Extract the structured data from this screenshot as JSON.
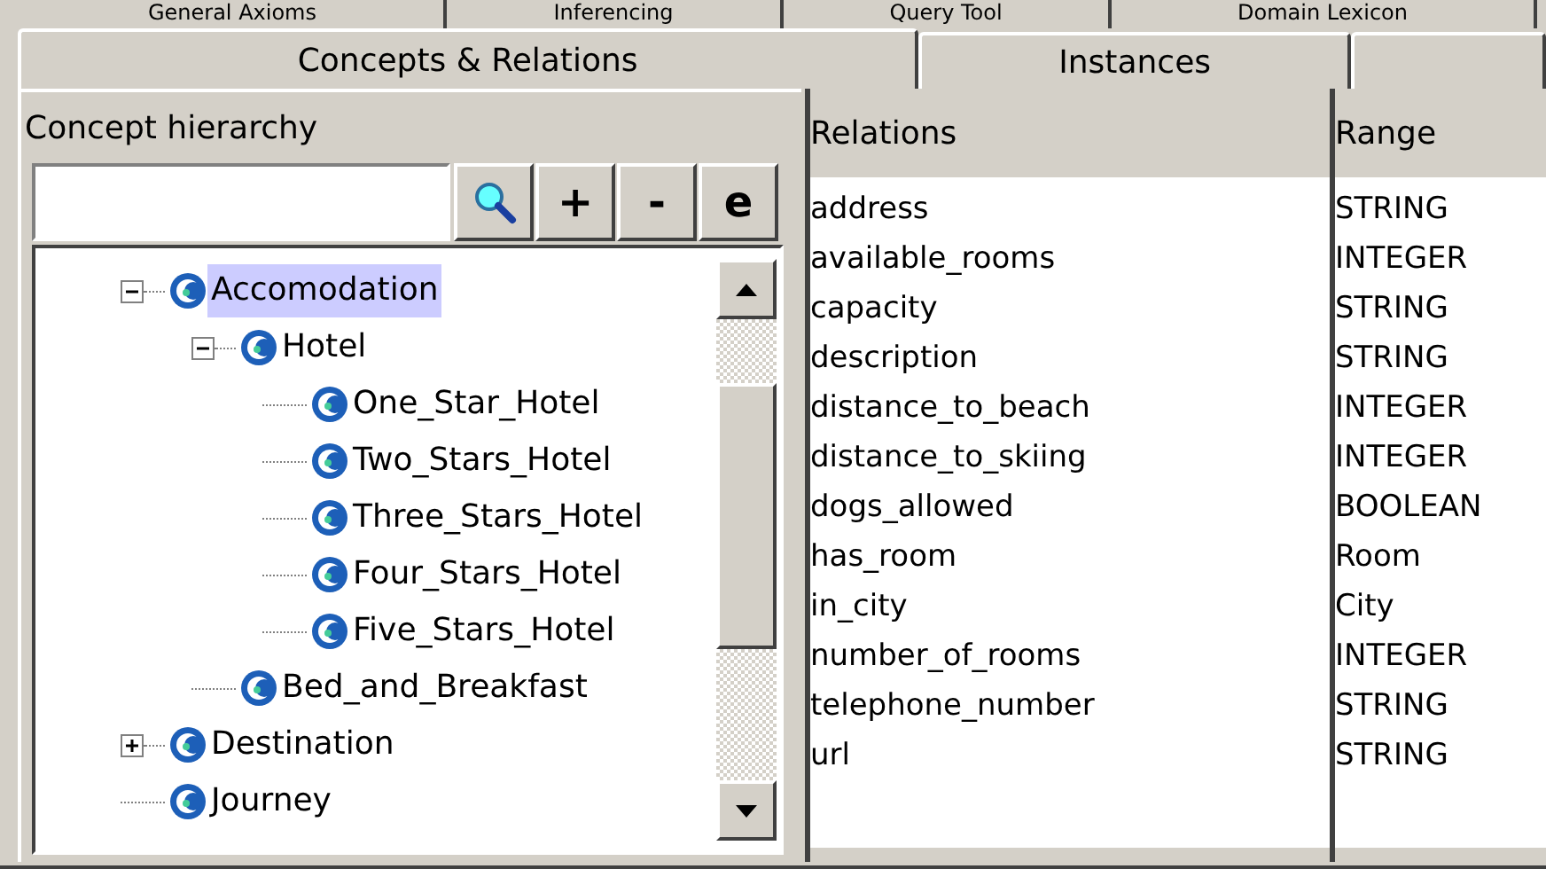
{
  "back_tabs": [
    {
      "label": "General Axioms"
    },
    {
      "label": "Inferencing"
    },
    {
      "label": "Query Tool"
    },
    {
      "label": "Domain Lexicon"
    }
  ],
  "tabs": [
    {
      "label": "Concepts & Relations",
      "selected": true
    },
    {
      "label": "Instances",
      "selected": false
    },
    {
      "selected": false
    }
  ],
  "concept_panel": {
    "title": "Concept hierarchy",
    "buttons": [
      {
        "kind": "search"
      },
      {
        "kind": "text",
        "label": "+"
      },
      {
        "kind": "text",
        "label": "-"
      },
      {
        "kind": "text",
        "label": "e"
      }
    ],
    "tree": [
      {
        "label": "Accomodation",
        "selected": true,
        "expanded": true,
        "children": [
          {
            "label": "Hotel",
            "selected": false,
            "expanded": true,
            "children": [
              {
                "label": "One_Star_Hotel",
                "selected": false
              },
              {
                "label": "Two_Stars_Hotel",
                "selected": false
              },
              {
                "label": "Three_Stars_Hotel",
                "selected": false
              },
              {
                "label": "Four_Stars_Hotel",
                "selected": false
              },
              {
                "label": "Five_Stars_Hotel",
                "selected": false
              }
            ]
          },
          {
            "label": "Bed_and_Breakfast",
            "selected": false
          }
        ]
      },
      {
        "label": "Destination",
        "selected": false,
        "expanded": false
      },
      {
        "label": "Journey",
        "selected": false
      }
    ]
  },
  "relations_table": {
    "columns": [
      "Relations",
      "Range"
    ],
    "rows": [
      {
        "relation": "address",
        "range": "STRING"
      },
      {
        "relation": "available_rooms",
        "range": "INTEGER"
      },
      {
        "relation": "capacity",
        "range": "STRING"
      },
      {
        "relation": "description",
        "range": "STRING"
      },
      {
        "relation": "distance_to_beach",
        "range": "INTEGER"
      },
      {
        "relation": "distance_to_skiing",
        "range": "INTEGER"
      },
      {
        "relation": "dogs_allowed",
        "range": "BOOLEAN"
      },
      {
        "relation": "has_room",
        "range": "Room"
      },
      {
        "relation": "in_city",
        "range": "City"
      },
      {
        "relation": "number_of_rooms",
        "range": "INTEGER"
      },
      {
        "relation": "telephone_number",
        "range": "STRING"
      },
      {
        "relation": "url",
        "range": "STRING"
      }
    ]
  }
}
